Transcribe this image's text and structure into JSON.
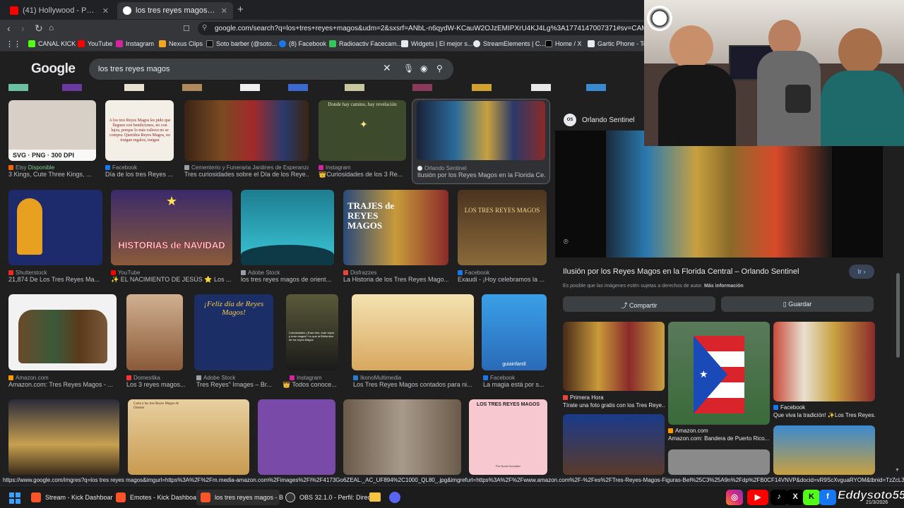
{
  "browser": {
    "tabs": [
      {
        "label": "(41) Hollywood - Peso Pluma, Esteva",
        "active": false
      },
      {
        "label": "los tres reyes magos - Buscar con",
        "active": true
      }
    ],
    "url": "google.com/search?q=los+tres+reyes+magos&udm=2&sxsrf=ANbL-n6qydW-KCauW2OJzEMIPXrU4KJ4Lg%3A1774147007371#sv=CAMSVhoyKhB",
    "bookmarks": [
      "CANAL KICK",
      "YouTube",
      "Instagram",
      "Nexus Clips",
      "Soto barber (@soto...",
      "(8) Facebook",
      "Radioactiv Facecam...",
      "Widgets | El mejor s...",
      "StreamElements | C...",
      "Home / X",
      "Gartic Phone - Tele"
    ]
  },
  "search": {
    "logo": "Google",
    "query": "los tres reyes magos"
  },
  "results": {
    "row1": [
      {
        "source": "Etsy",
        "badge": "Disponible",
        "title": "3 Kings, Cute Three Kings, ...",
        "overlay": "SVG · PNG · 300 DPI",
        "color": "#d8d0c6"
      },
      {
        "source": "Facebook",
        "title": "Día de los tres Reyes ...",
        "overlay": "A los tres Reyes Magos les pido que lleguen con bendiciones, no con lujos, porque lo más valioso no se compra. Queridos Reyes Magos, no traigan regalos, traigan",
        "color": "#f3efe6"
      },
      {
        "source": "Cementerio y Funeraria Jardines de Esperanza",
        "title": "Tres curiosidades sobre el Día de los Reye...",
        "color": "#5a3a22"
      },
      {
        "source": "Instagram",
        "title": "👑Curiosidades de los 3 Re...",
        "overlay": "Donde hay camino, hay revelación",
        "color": "#3d4a2c"
      },
      {
        "source": "Orlando Sentinel",
        "title": "Ilusión por los Reyes Magos en la Florida Ce...",
        "color": "#2a3a52"
      }
    ],
    "row2": [
      {
        "source": "Shutterstock",
        "title": "21,874 De Los Tres Reyes Ma...",
        "color": "#1d2a6b"
      },
      {
        "source": "YouTube",
        "title": "✨ EL NACIMIENTO DE JESÚS ⭐ Los ...",
        "overlay": "HISTORIAS de NAVIDAD",
        "color": "#6a3a8a"
      },
      {
        "source": "Adobe Stock",
        "title": "los tres reyes magos de orient...",
        "color": "#2aa6b8"
      },
      {
        "source": "Disfrazzes",
        "title": "La Historia de los Tres Reyes Mago...",
        "overlay": "TRAJES de REYES MAGOS",
        "color": "#7a2a2a"
      },
      {
        "source": "Facebook",
        "title": "Exaudi - ¡Hoy celebramos la ...",
        "overlay": "LOS TRES REYES MAGOS",
        "color": "#4a3420"
      }
    ],
    "row3": [
      {
        "source": "Amazon.com",
        "title": "Amazon.com: Tres Reyes Magos - ...",
        "color": "#f2f2f2"
      },
      {
        "source": "Domestika",
        "title": "Los 3 reyes magos...",
        "color": "#b0805a"
      },
      {
        "source": "Adobe Stock",
        "title": "Tres Reyes\" Images – Br...",
        "overlay": "¡Feliz día de Reyes Magos!",
        "color": "#1b2f66"
      },
      {
        "source": "Instagram",
        "title": "👑 Todos conoce...",
        "overlay": "Curiosidades ¿Eran tres, eran reyes y eran magos? Lo que la Biblia dice de los reyes Magos",
        "color": "#3a3a2a"
      },
      {
        "source": "IkonoMultimedia",
        "title": "Los Tres Reyes Magos contados para ni...",
        "color": "#e8c98a"
      },
      {
        "source": "Facebook",
        "title": "La magia está por s...",
        "overlay": "guiainfantil",
        "color": "#2a8ad0"
      }
    ],
    "row4": [
      {
        "color": "#c8a050"
      },
      {
        "overlay": "Carta a los tres Reyes Magos de Oriente",
        "color": "#c89a50"
      },
      {
        "color": "#7a4aa8"
      },
      {
        "color": "#8a7a6a"
      },
      {
        "overlay": "LOS TRES REYES MAGOS",
        "caption": "Por Nuria González",
        "color": "#f7c8d0"
      }
    ]
  },
  "panel": {
    "source": "Orlando Sentinel",
    "source_short": "OS",
    "title": "Ilusión por los Reyes Magos en la Florida Central – Orlando Sentinel",
    "go_label": "Ir",
    "note": "Es posible que las imágenes estén sujetas a derechos de autor.",
    "note_link": "Más información",
    "share_label": "Compartir",
    "save_label": "Guardar",
    "related": [
      {
        "source": "Primera Hora",
        "title": "Tírate una foto gratis con los Tres Reye...",
        "color": "#6a2a2a"
      },
      {
        "source": "Amazon.com",
        "title": "Amazon.com: Bandera de Puerto Rico...",
        "color": "#3a6a3a"
      },
      {
        "source": "Facebook",
        "title": "Que viva la tradición! ✨Los Tres Reyes...",
        "color": "#8a3a3a"
      }
    ]
  },
  "status_url": "https://www.google.com/imgres?q=los tres reyes magos&imgurl=https%3A%2F%2Fm.media-amazon.com%2Fimages%2FI%2F4173Go6ZEAL._AC_UF894%2C1000_QL80_.jpg&imgrefurl=https%3A%2F%2Fwww.amazon.com%2F-%2Fes%2FTres-Reyes-Magos-Figuras-Bel%25C3%25A9n%2Fdp%2FB0CF14VNVP&docid=vR9ScXvguaRYOM&tbnid=TzZcL3_Vn...",
  "taskbar": {
    "items": [
      "Stream - Kick Dashboar",
      "Emotes - Kick Dashboar",
      "los tres reyes magos - B",
      "OBS 32.1.0 - Perfil: Direc"
    ],
    "handle": "Eddysoto55",
    "date": "21/3/2026"
  }
}
